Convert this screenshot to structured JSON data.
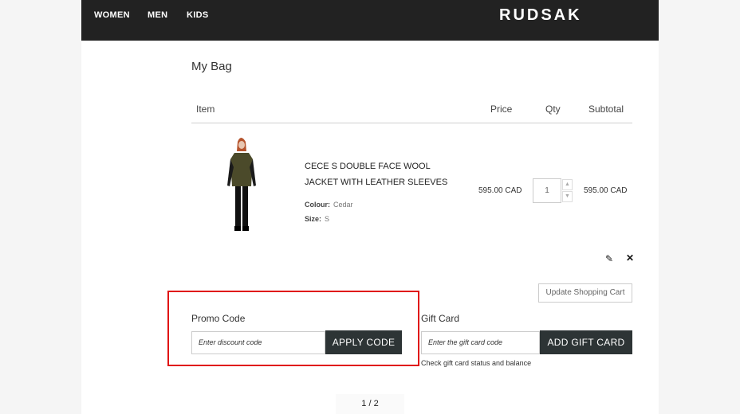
{
  "nav": {
    "women": "WOMEN",
    "men": "MEN",
    "kids": "KIDS",
    "logo": "RUDSAK"
  },
  "cart": {
    "title": "My Bag",
    "headers": {
      "item": "Item",
      "price": "Price",
      "qty": "Qty",
      "subtotal": "Subtotal"
    },
    "item": {
      "name": "CECE S DOUBLE FACE WOOL JACKET WITH LEATHER SLEEVES",
      "colour_label": "Colour:",
      "colour_value": "Cedar",
      "size_label": "Size:",
      "size_value": "S",
      "price": "595.00 CAD",
      "qty": "1",
      "subtotal": "595.00 CAD"
    },
    "update_button": "Update Shopping Cart"
  },
  "promo": {
    "label": "Promo Code",
    "placeholder": "Enter discount code",
    "button": "APPLY CODE"
  },
  "gift": {
    "label": "Gift Card",
    "placeholder": "Enter the gift card code",
    "button": "ADD GIFT CARD",
    "link": "Check gift card status and balance"
  },
  "pager": {
    "text": "1 / 2"
  },
  "colors": {
    "header_bg": "#222222",
    "button_bg": "#2d3435",
    "highlight": "#e01414"
  },
  "icons": [
    "pencil-icon",
    "close-icon",
    "chevron-up-icon",
    "chevron-down-icon"
  ]
}
